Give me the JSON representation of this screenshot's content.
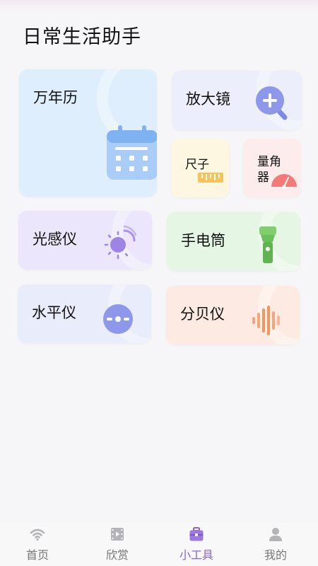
{
  "page": {
    "title": "日常生活助手"
  },
  "tools": {
    "calendar": {
      "label": "万年历"
    },
    "magnifier": {
      "label": "放大镜"
    },
    "ruler": {
      "label": "尺子"
    },
    "protractor": {
      "label": "量角器"
    },
    "light_meter": {
      "label": "光感仪"
    },
    "flashlight": {
      "label": "手电筒"
    },
    "level": {
      "label": "水平仪"
    },
    "decibel": {
      "label": "分贝仪"
    }
  },
  "tabbar": {
    "items": [
      {
        "label": "首页",
        "icon": "wifi-icon",
        "active": false
      },
      {
        "label": "欣赏",
        "icon": "film-icon",
        "active": false
      },
      {
        "label": "小工具",
        "icon": "toolbox-icon",
        "active": true
      },
      {
        "label": "我的",
        "icon": "person-icon",
        "active": false
      }
    ]
  },
  "colors": {
    "accent": "#8a63d2",
    "calendar_bg": "#dfeefc",
    "magnifier_bg": "#eceefb",
    "ruler_bg": "#fdf7e2",
    "protractor_bg": "#fdecec",
    "light_meter_bg": "#ebe6fb",
    "flashlight_bg": "#e6f6e4",
    "level_bg": "#e9ecfa",
    "decibel_bg": "#fdebe3"
  }
}
